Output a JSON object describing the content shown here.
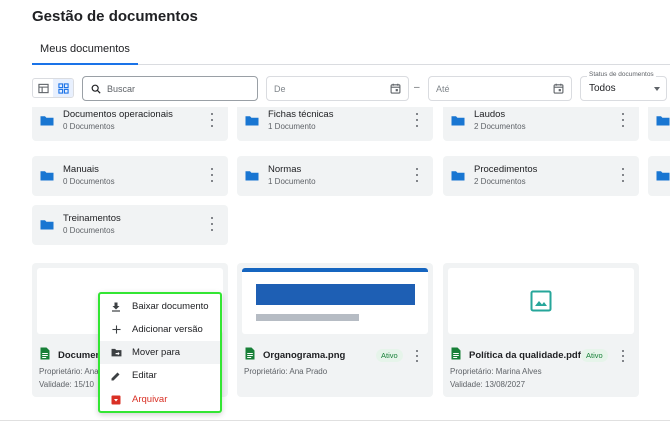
{
  "page": {
    "title": "Gestão de documentos"
  },
  "tabs": [
    {
      "label": "Meus documentos",
      "active": true
    }
  ],
  "toolbar": {
    "view_options": [
      "table-view-icon",
      "grid-view-icon"
    ],
    "active_view": "grid",
    "search": {
      "placeholder": "Buscar",
      "value": ""
    },
    "date_from": {
      "placeholder": "De"
    },
    "date_separator": "–",
    "date_to": {
      "placeholder": "Até"
    },
    "status_filter": {
      "label": "Status de documentos",
      "value": "Todos"
    }
  },
  "folders": [
    {
      "name": "Documentos operacionais",
      "count": "0 Documentos"
    },
    {
      "name": "Fichas técnicas",
      "count": "1 Documento"
    },
    {
      "name": "Laudos",
      "count": "2 Documentos"
    },
    {
      "name": "Manuais",
      "count": "0 Documentos"
    },
    {
      "name": "Normas",
      "count": "1 Documento"
    },
    {
      "name": "Procedimentos",
      "count": "2 Documentos"
    },
    {
      "name": "Treinamentos",
      "count": "0 Documentos"
    }
  ],
  "documents": [
    {
      "name": "Documen",
      "owner": "Proprietário: Ana",
      "validity": "Validade: 15/10",
      "status": ""
    },
    {
      "name": "Organograma.png",
      "owner": "Proprietário: Ana Prado",
      "validity": "",
      "status": "Ativo"
    },
    {
      "name": "Política da qualidade.pdf",
      "owner": "Proprietário: Marina Alves",
      "validity": "Validade: 13/08/2027",
      "status": "Ativo"
    }
  ],
  "context_menu": {
    "items": [
      {
        "label": "Baixar documento",
        "icon": "download-icon"
      },
      {
        "label": "Adicionar versão",
        "icon": "plus-icon"
      },
      {
        "label": "Mover para",
        "icon": "folder-move-icon"
      },
      {
        "label": "Editar",
        "icon": "pencil-icon"
      },
      {
        "label": "Arquivar",
        "icon": "archive-icon"
      }
    ]
  },
  "colors": {
    "accent": "#1a73e8",
    "folder_icon": "#1976d2",
    "file_icon": "#188038",
    "badge_bg": "#e6f4ea",
    "danger": "#d93025",
    "menu_highlight": "#33e633"
  }
}
